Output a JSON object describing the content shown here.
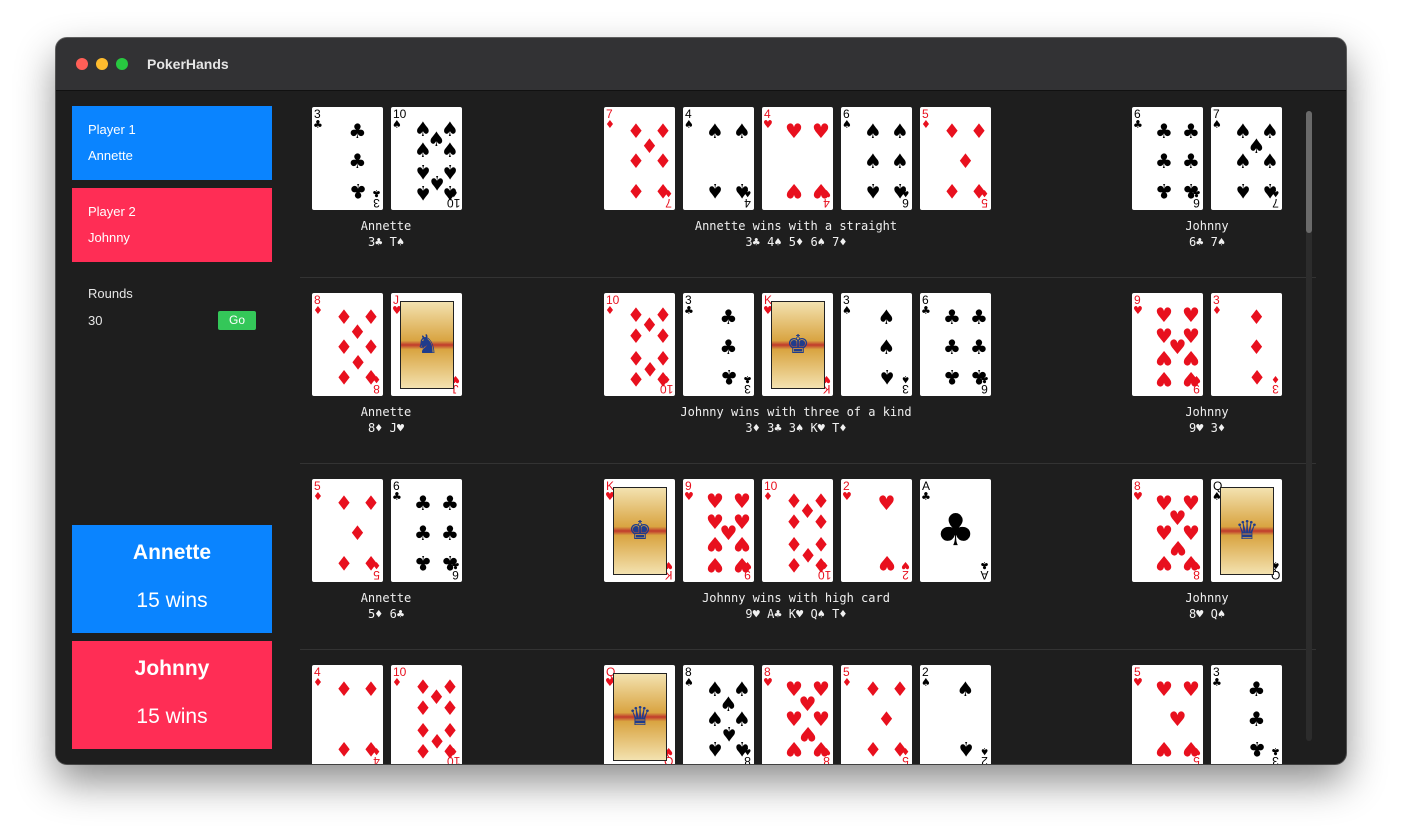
{
  "window": {
    "title": "PokerHands"
  },
  "colors": {
    "player1": "#0a84ff",
    "player2": "#ff2d55",
    "go": "#34c759",
    "red_suit": "#e8101e",
    "black_suit": "#000000"
  },
  "sidebar": {
    "player1": {
      "label": "Player 1",
      "name": "Annette"
    },
    "player2": {
      "label": "Player 2",
      "name": "Johnny"
    },
    "rounds_label": "Rounds",
    "rounds_value": "30",
    "go_label": "Go"
  },
  "scoreboard": [
    {
      "name": "Annette",
      "wins": "15 wins"
    },
    {
      "name": "Johnny",
      "wins": "15 wins"
    }
  ],
  "rounds": [
    {
      "p1_cards": [
        {
          "rank": "3",
          "suit": "♣"
        },
        {
          "rank": "10",
          "suit": "♠"
        }
      ],
      "board": [
        {
          "rank": "7",
          "suit": "♦"
        },
        {
          "rank": "4",
          "suit": "♠"
        },
        {
          "rank": "4",
          "suit": "♥"
        },
        {
          "rank": "6",
          "suit": "♠"
        },
        {
          "rank": "5",
          "suit": "♦"
        }
      ],
      "p2_cards": [
        {
          "rank": "6",
          "suit": "♣"
        },
        {
          "rank": "7",
          "suit": "♠"
        }
      ],
      "p1_name": "Annette",
      "p1_hand": "3♣ T♠",
      "result": "Annette wins with a straight",
      "best_hand": "3♣ 4♠ 5♦ 6♠ 7♦",
      "p2_name": "Johnny",
      "p2_hand": "6♣ 7♠"
    },
    {
      "p1_cards": [
        {
          "rank": "8",
          "suit": "♦"
        },
        {
          "rank": "J",
          "suit": "♥"
        }
      ],
      "board": [
        {
          "rank": "10",
          "suit": "♦"
        },
        {
          "rank": "3",
          "suit": "♣"
        },
        {
          "rank": "K",
          "suit": "♥"
        },
        {
          "rank": "3",
          "suit": "♠"
        },
        {
          "rank": "6",
          "suit": "♣"
        }
      ],
      "p2_cards": [
        {
          "rank": "9",
          "suit": "♥"
        },
        {
          "rank": "3",
          "suit": "♦"
        }
      ],
      "p1_name": "Annette",
      "p1_hand": "8♦ J♥",
      "result": "Johnny wins with three of a kind",
      "best_hand": "3♦ 3♣ 3♠ K♥ T♦",
      "p2_name": "Johnny",
      "p2_hand": "9♥ 3♦"
    },
    {
      "p1_cards": [
        {
          "rank": "5",
          "suit": "♦"
        },
        {
          "rank": "6",
          "suit": "♣"
        }
      ],
      "board": [
        {
          "rank": "K",
          "suit": "♥"
        },
        {
          "rank": "9",
          "suit": "♥"
        },
        {
          "rank": "10",
          "suit": "♦"
        },
        {
          "rank": "2",
          "suit": "♥"
        },
        {
          "rank": "A",
          "suit": "♣"
        }
      ],
      "p2_cards": [
        {
          "rank": "8",
          "suit": "♥"
        },
        {
          "rank": "Q",
          "suit": "♠"
        }
      ],
      "p1_name": "Annette",
      "p1_hand": "5♦ 6♣",
      "result": "Johnny wins with high card",
      "best_hand": "9♥ A♣ K♥ Q♠ T♦",
      "p2_name": "Johnny",
      "p2_hand": "8♥ Q♠"
    },
    {
      "p1_cards": [
        {
          "rank": "4",
          "suit": "♦"
        },
        {
          "rank": "10",
          "suit": "♦"
        }
      ],
      "board": [
        {
          "rank": "Q",
          "suit": "♥"
        },
        {
          "rank": "8",
          "suit": "♠"
        },
        {
          "rank": "8",
          "suit": "♥"
        },
        {
          "rank": "5",
          "suit": "♦"
        },
        {
          "rank": "2",
          "suit": "♠"
        }
      ],
      "p2_cards": [
        {
          "rank": "5",
          "suit": "♥"
        },
        {
          "rank": "3",
          "suit": "♣"
        }
      ],
      "p1_name": "",
      "p1_hand": "",
      "result": "",
      "best_hand": "",
      "p2_name": "",
      "p2_hand": ""
    }
  ]
}
